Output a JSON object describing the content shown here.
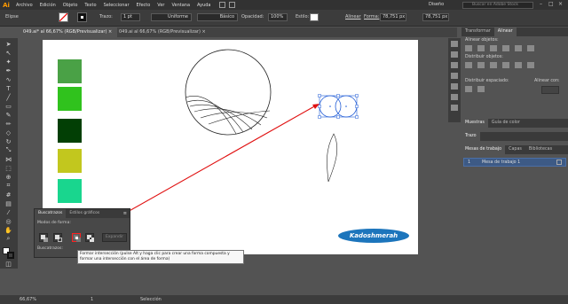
{
  "app": {
    "logo": "Ai"
  },
  "menu": [
    "Archivo",
    "Edición",
    "Objeto",
    "Texto",
    "Seleccionar",
    "Efecto",
    "Ver",
    "Ventana",
    "Ayuda"
  ],
  "workspace": "Diseño",
  "search_placeholder": "Buscar en Adobe Stock",
  "control": {
    "object_type": "Elipse",
    "stroke_label": "Trazo:",
    "stroke_value": "1 pt",
    "profile": "Uniforme",
    "brush": "Básico",
    "opacity_label": "Opacidad:",
    "opacity_value": "100%",
    "style_label": "Estilo:",
    "align_label": "Alinear",
    "shape_label": "Forma:",
    "width_value": "78,751 px",
    "height_value": "78,751 px"
  },
  "doc_tabs": [
    "049.ai* al 66,67% (RGB/Previsualizar)",
    "049.ai al 66,67% (RGB/Previsualizar)"
  ],
  "artboard": {
    "swatches": [
      "#4aa146",
      "#30c21d",
      "#023f05",
      "#c2c71e",
      "#19d68e"
    ],
    "badge_text": "Kadoshmerah",
    "arrow_color": "#e01010",
    "selection_color": "#1f5bd6"
  },
  "pathfinder": {
    "tabs": [
      "Buscatrazos",
      "Estilos gráficos"
    ],
    "modes_label": "Modos de forma:",
    "expand_label": "Expandir",
    "finders_label": "Buscatrazos:"
  },
  "tooltip": "Formar intersección (pulse Alt y haga clic para crear una forma compuesta y formar una intersección con el área de forma)",
  "right_panel": {
    "tabs1": [
      "Transformar",
      "Alinear"
    ],
    "align_objects": "Alinear objetos:",
    "distribute_objects": "Distribuir objetos:",
    "distribute_spacing": "Distribuir espaciado:",
    "align_to": "Alinear con:",
    "tabs2": [
      "Muestras",
      "Guía de color"
    ],
    "stroke_tab": "Trazo",
    "tabs3": [
      "Mesas de trabajo",
      "Capas",
      "Bibliotecas"
    ],
    "artboard_row_index": "1",
    "artboard_row_name": "Mesa de trabajo 1"
  },
  "status": {
    "zoom": "66,67%",
    "page": "1",
    "tool": "Selección"
  }
}
